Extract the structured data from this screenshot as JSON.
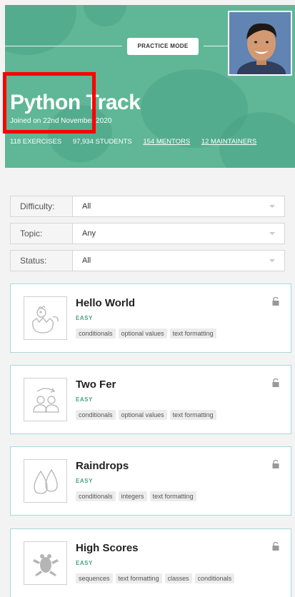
{
  "hero": {
    "practice_label": "PRACTICE MODE",
    "title": "Python Track",
    "joined": "Joined on 22nd November 2020",
    "stats": {
      "exercises": "118 EXERCISES",
      "students": "97,934 STUDENTS",
      "mentors": "154 MENTORS",
      "maintainers": "12 MAINTAINERS"
    },
    "bg_color": "#5fb797"
  },
  "filters": [
    {
      "label": "Difficulty:",
      "value": "All"
    },
    {
      "label": "Topic:",
      "value": "Any"
    },
    {
      "label": "Status:",
      "value": "All"
    }
  ],
  "exercises": [
    {
      "name": "Hello World",
      "difficulty": "EASY",
      "icon": "hatching-chick-icon",
      "tags": [
        "conditionals",
        "optional values",
        "text formatting"
      ]
    },
    {
      "name": "Two Fer",
      "difficulty": "EASY",
      "icon": "two-people-icon",
      "tags": [
        "conditionals",
        "optional values",
        "text formatting"
      ]
    },
    {
      "name": "Raindrops",
      "difficulty": "EASY",
      "icon": "raindrops-icon",
      "tags": [
        "conditionals",
        "integers",
        "text formatting"
      ]
    },
    {
      "name": "High Scores",
      "difficulty": "EASY",
      "icon": "frog-icon",
      "tags": [
        "sequences",
        "text formatting",
        "classes",
        "conditionals"
      ]
    }
  ],
  "colors": {
    "accent": "#4aa37f",
    "card_border": "#a9d8dc",
    "highlight": "#ff0000"
  }
}
